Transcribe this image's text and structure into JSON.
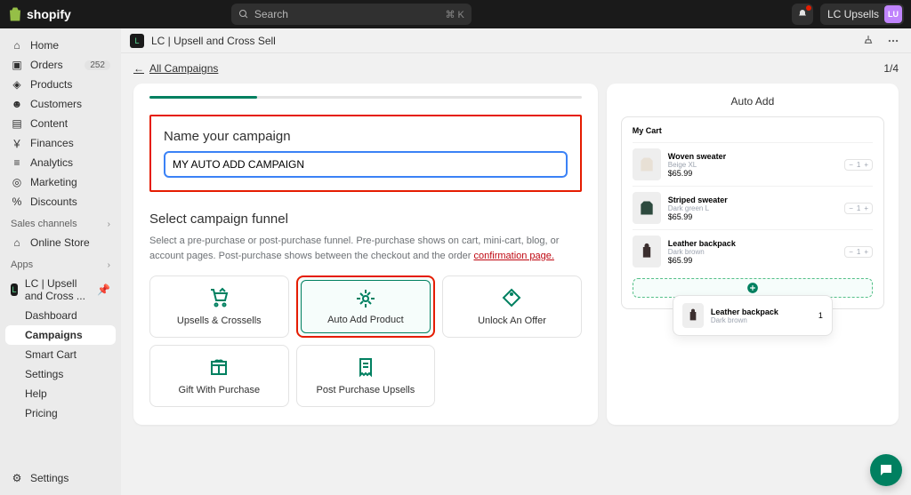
{
  "topbar": {
    "logo_text": "shopify",
    "search_placeholder": "Search",
    "search_shortcut": "⌘ K",
    "user_label": "LC Upsells",
    "avatar_initials": "LU"
  },
  "nav": {
    "home": "Home",
    "orders": "Orders",
    "orders_badge": "252",
    "products": "Products",
    "customers": "Customers",
    "content": "Content",
    "finances": "Finances",
    "analytics": "Analytics",
    "marketing": "Marketing",
    "discounts": "Discounts",
    "sales_section": "Sales channels",
    "online_store": "Online Store",
    "apps_section": "Apps",
    "app_name": "LC | Upsell and Cross ...",
    "sub_dashboard": "Dashboard",
    "sub_campaigns": "Campaigns",
    "sub_smart_cart": "Smart Cart",
    "sub_settings": "Settings",
    "sub_help": "Help",
    "sub_pricing": "Pricing",
    "footer_settings": "Settings"
  },
  "header": {
    "app_title": "LC | Upsell and Cross Sell"
  },
  "page": {
    "back_label": "All Campaigns",
    "step": "1/4",
    "name_label": "Name your campaign",
    "name_value": "MY AUTO ADD CAMPAIGN",
    "funnel_title": "Select campaign funnel",
    "funnel_desc_1": "Select a pre-purchase or post-purchase funnel. Pre-purchase shows on cart, mini-cart, blog, or account pages. Post-purchase shows between the checkout and the order ",
    "funnel_desc_link": "confirmation page.",
    "tiles": {
      "upsells": "Upsells & Crossells",
      "auto_add": "Auto Add Product",
      "unlock": "Unlock An Offer",
      "gift": "Gift With Purchase",
      "post": "Post Purchase Upsells"
    }
  },
  "preview": {
    "title": "Auto Add",
    "cart_title": "My Cart",
    "items": [
      {
        "name": "Woven sweater",
        "variant": "Beige XL",
        "price": "$65.99",
        "qty": "1"
      },
      {
        "name": "Striped sweater",
        "variant": "Dark green L",
        "price": "$65.99",
        "qty": "1"
      },
      {
        "name": "Leather backpack",
        "variant": "Dark brown",
        "price": "$65.99",
        "qty": "1"
      }
    ],
    "popup_name": "Leather backpack",
    "popup_variant": "Dark brown",
    "popup_qty": "1"
  }
}
